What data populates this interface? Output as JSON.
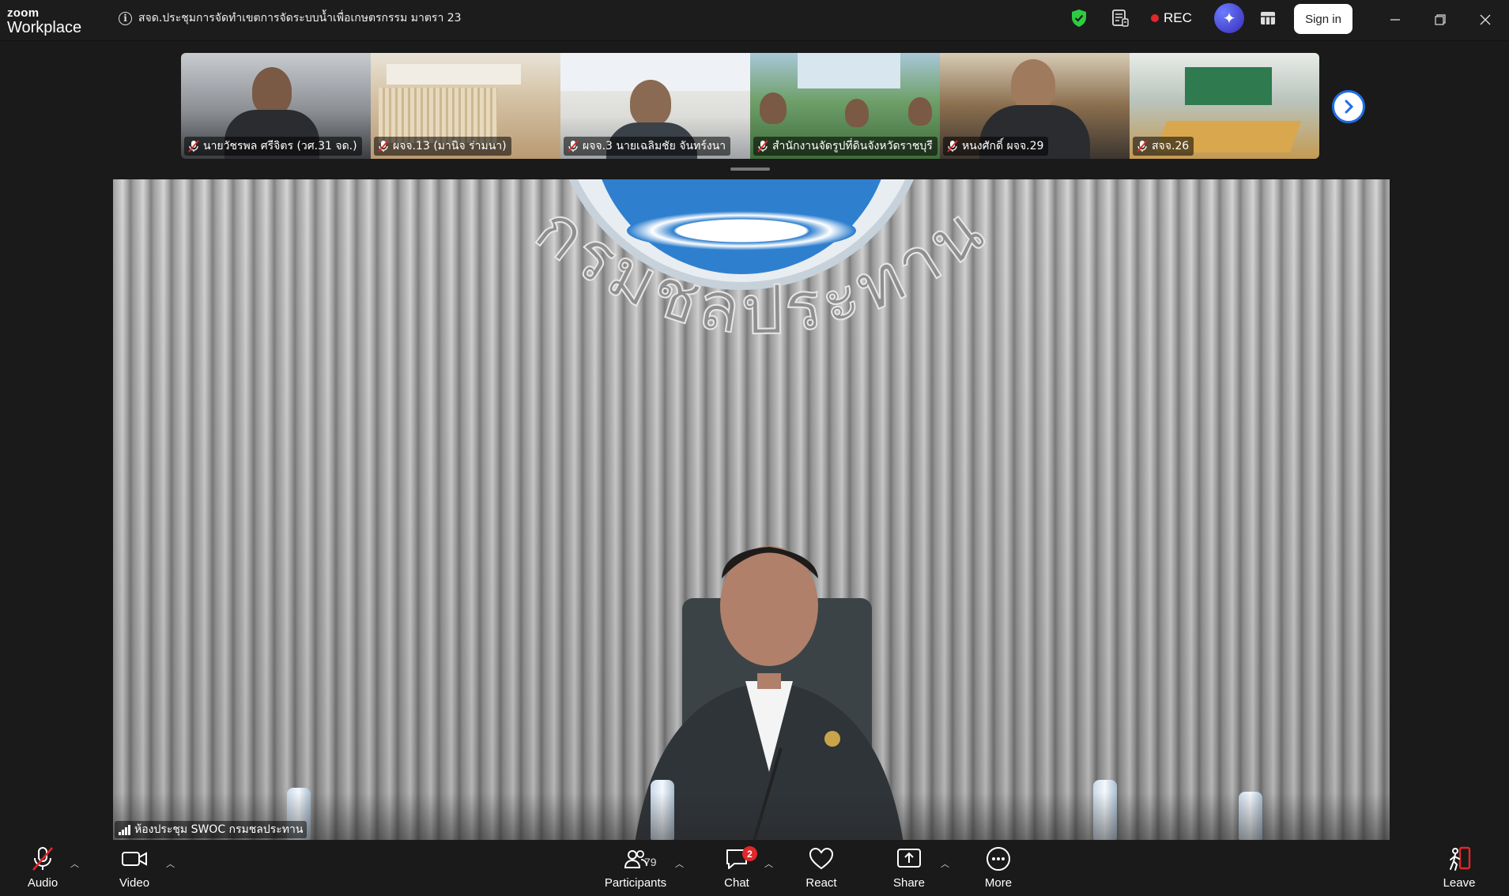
{
  "app": {
    "brand_top": "zoom",
    "brand_bottom": "Workplace"
  },
  "meeting": {
    "title": "สจด.ประชุมการจัดทำเขตการจัดระบบน้ำเพื่อเกษตรกรรม มาตรา 23"
  },
  "titlebar": {
    "rec_label": "REC",
    "signin_label": "Sign in",
    "icons": [
      "shield-check-icon",
      "meeting-notes-icon",
      "ai-companion-icon",
      "apps-icon",
      "minimize-icon",
      "restore-icon",
      "close-icon"
    ]
  },
  "gallery": {
    "tiles": [
      {
        "name": "นายวัชรพล ศรีจิตร (วศ.31 จด.)",
        "bg": "#7a7f85",
        "muted": true
      },
      {
        "name": "ผจจ.13 (มานิจ ร่ามนา)",
        "bg": "#c9b7a0",
        "muted": true
      },
      {
        "name": "ผจจ.3 นายเฉลิมชัย จันทร์งนา",
        "bg": "#d9dce0",
        "muted": true
      },
      {
        "name": "สำนักงานจัดรูปที่ดินจังหวัดราชบุรี",
        "bg": "#5d8a54",
        "muted": true
      },
      {
        "name": "หนงศักดิ์ ผจจ.29",
        "bg": "#8a6e4e",
        "muted": true
      },
      {
        "name": "สจจ.26",
        "bg": "#9aa7a0",
        "muted": true
      }
    ],
    "next_icon": "chevron-right-icon"
  },
  "main_video": {
    "speaker_label": "ห้องประชุม SWOC กรมชลประทาน",
    "wall_text": "กรมชลประทาน"
  },
  "toolbar": {
    "audio_label": "Audio",
    "video_label": "Video",
    "participants_label": "Participants",
    "participants_count": "79",
    "chat_label": "Chat",
    "chat_badge": "2",
    "react_label": "React",
    "share_label": "Share",
    "more_label": "More",
    "leave_label": "Leave"
  },
  "colors": {
    "accent_blue": "#1e6ee6",
    "rec_red": "#e0272b",
    "leave_red": "#e0272b",
    "shield_green": "#2ecc40"
  }
}
